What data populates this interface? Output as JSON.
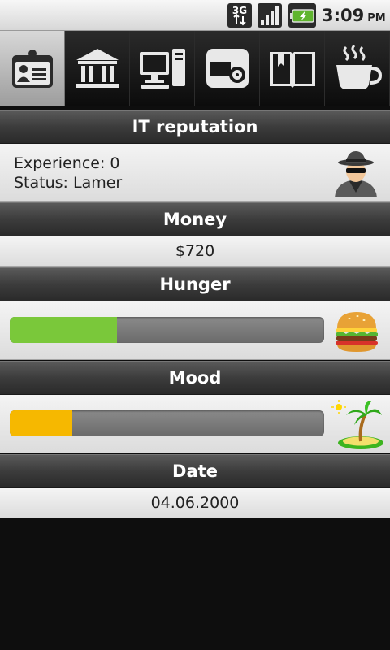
{
  "status_bar": {
    "network": "3G",
    "time": "3:09",
    "ampm": "PM"
  },
  "tabs": [
    {
      "icon": "id-card-icon",
      "active": true
    },
    {
      "icon": "bank-icon",
      "active": false
    },
    {
      "icon": "computer-icon",
      "active": false
    },
    {
      "icon": "disk-drive-icon",
      "active": false
    },
    {
      "icon": "book-icon",
      "active": false
    },
    {
      "icon": "coffee-cup-icon",
      "active": false
    }
  ],
  "reputation": {
    "title": "IT reputation",
    "experience": "Experience: 0",
    "status": "Status: Lamer",
    "avatar_icon": "spy-avatar-icon"
  },
  "money": {
    "title": "Money",
    "value": "$720"
  },
  "hunger": {
    "title": "Hunger",
    "level": 0.34,
    "color": "#7ac83a",
    "icon": "burger-icon"
  },
  "mood": {
    "title": "Mood",
    "level": 0.2,
    "color": "#f6b800",
    "icon": "palm-island-icon"
  },
  "date": {
    "title": "Date",
    "value": "04.06.2000"
  }
}
